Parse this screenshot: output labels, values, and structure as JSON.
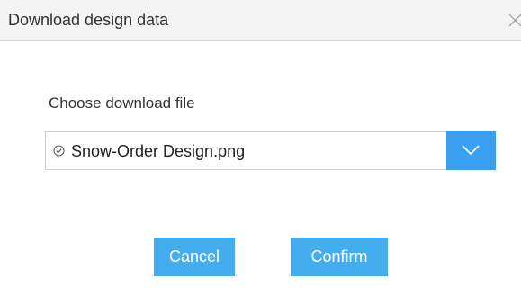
{
  "dialog": {
    "title": "Download design data",
    "close_icon": "close-icon"
  },
  "form": {
    "choose_label": "Choose download file",
    "file_select": {
      "selected_value": "Snow-Order Design.png",
      "status_icon": "check-circle-icon",
      "dropdown_icon": "chevron-down-icon"
    }
  },
  "buttons": {
    "cancel_label": "Cancel",
    "confirm_label": "Confirm"
  },
  "colors": {
    "accent": "#44adf0",
    "dropdown_button": "#3b9ff0",
    "titlebar_bg": "#f4f4f4"
  }
}
